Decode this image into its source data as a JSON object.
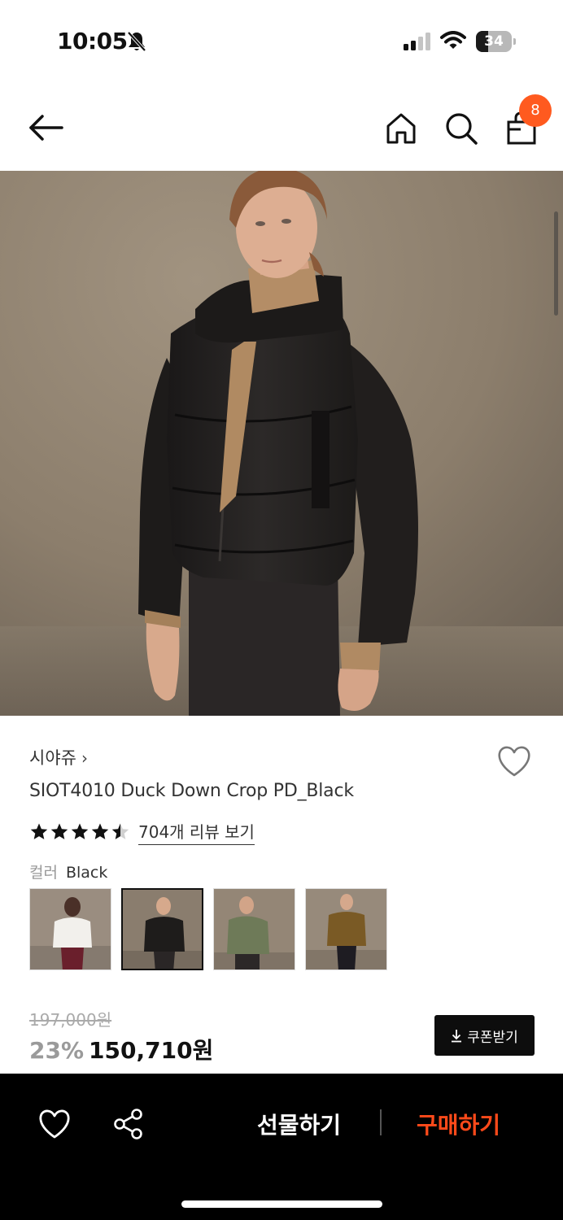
{
  "status_bar": {
    "time": "10:05",
    "battery_level": "34",
    "battery_fraction": 0.34
  },
  "nav": {
    "cart_count": "8",
    "icons": [
      "back-arrow-icon",
      "home-icon",
      "search-icon",
      "shopping-bag-icon"
    ]
  },
  "product": {
    "brand": "시야쥬",
    "name": "SIOT4010 Duck Down Crop PD_Black",
    "rating": 4.5,
    "review_link": "704개 리뷰 보기",
    "color_label": "컬러",
    "color_value": "Black",
    "color_options": [
      "White",
      "Black",
      "Khaki",
      "Brown"
    ],
    "selected_color_index": 1,
    "original_price": "197,000원",
    "discount": "23%",
    "sale_price": "150,710원",
    "coupon_label": "쿠폰받기"
  },
  "bottom_bar": {
    "gift_label": "선물하기",
    "buy_label": "구매하기"
  },
  "colors": {
    "accent": "#ff4a1a",
    "badge": "#ff5a1f",
    "bottom_bar_bg": "#000000"
  }
}
